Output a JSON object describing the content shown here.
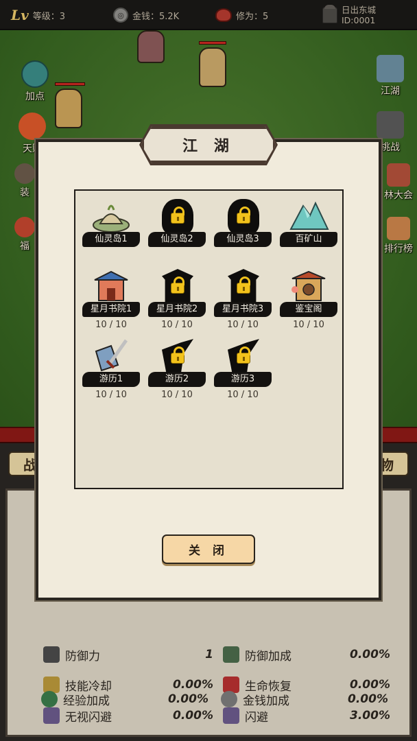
{
  "topbar": {
    "level_icon": "Lv",
    "level_text": "等级：3",
    "gold_text": "金钱：5.2K",
    "cultivation_text": "修为：5",
    "player_name": "日出东城",
    "player_id": "ID:0001"
  },
  "field": {
    "left_icons": [
      "加点",
      "天赋",
      "装",
      "福"
    ],
    "right_icons": [
      "江湖",
      "挑战",
      "林大会",
      "排行榜"
    ]
  },
  "bottom": {
    "tab_left": "战",
    "tab_right": "物",
    "stats": [
      {
        "name": "防御力",
        "value": "1"
      },
      {
        "name": "防御加成",
        "value": "0.00%"
      },
      {
        "name": "技能冷却",
        "value": "0.00%"
      },
      {
        "name": "生命恢复",
        "value": "0.00%"
      },
      {
        "name": "无视闪避",
        "value": "0.00%"
      },
      {
        "name": "闪避",
        "value": "3.00%"
      },
      {
        "name": "经验加成",
        "value": "0.00%"
      },
      {
        "name": "金钱加成",
        "value": "0.00%"
      }
    ]
  },
  "dialog": {
    "title": "江 湖",
    "close_label": "关 闭",
    "items": [
      {
        "label": "仙灵岛1",
        "count": "",
        "locked": false,
        "icon": "island-icon"
      },
      {
        "label": "仙灵岛2",
        "count": "",
        "locked": true,
        "icon": "lock-icon"
      },
      {
        "label": "仙灵岛3",
        "count": "",
        "locked": true,
        "icon": "lock-icon"
      },
      {
        "label": "百矿山",
        "count": "",
        "locked": false,
        "icon": "mountain-icon"
      },
      {
        "label": "星月书院1",
        "count": "10 / 10",
        "locked": false,
        "icon": "academy-icon"
      },
      {
        "label": "星月书院2",
        "count": "10 / 10",
        "locked": true,
        "icon": "lock-icon"
      },
      {
        "label": "星月书院3",
        "count": "10 / 10",
        "locked": true,
        "icon": "lock-icon"
      },
      {
        "label": "鉴宝阁",
        "count": "10 / 10",
        "locked": false,
        "icon": "treasure-pavilion-icon"
      },
      {
        "label": "游历1",
        "count": "10 / 10",
        "locked": false,
        "icon": "sword-icon"
      },
      {
        "label": "游历2",
        "count": "10 / 10",
        "locked": true,
        "icon": "lock-icon"
      },
      {
        "label": "游历3",
        "count": "10 / 10",
        "locked": true,
        "icon": "lock-icon"
      }
    ]
  },
  "colors": {
    "grass": "#3c6a24",
    "paper": "#f1ebdc",
    "lock_gold": "#f2c21c",
    "button_fill": "#f6d7a6"
  }
}
